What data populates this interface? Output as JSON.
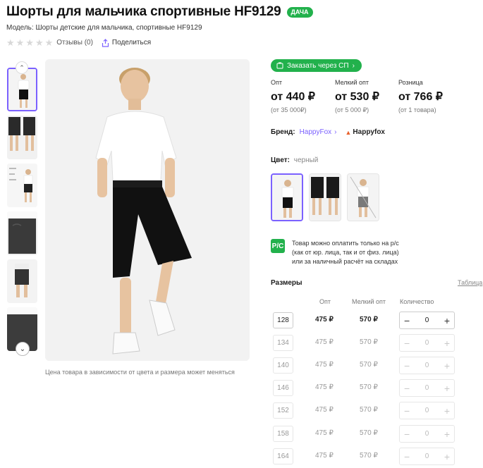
{
  "product": {
    "title": "Шорты для мальчика спортивные HF9129",
    "badge": "ДАЧА",
    "model_line": "Модель: Шорты детские для мальчика, спортивные HF9129",
    "reviews": "Отзывы (0)",
    "share": "Поделиться",
    "rating_stars": 0
  },
  "gallery": {
    "note": "Цена товара в зависимости от цвета и размера может меняться",
    "thumb_count": 6,
    "active_index": 0
  },
  "order_sp": {
    "label": "Заказать через СП",
    "icon": "cart-icon"
  },
  "prices": [
    {
      "label": "Опт",
      "value": "от 440 ₽",
      "sub": "(от 35 000₽)"
    },
    {
      "label": "Мелкий опт",
      "value": "от 530 ₽",
      "sub": "(от 5 000 ₽)"
    },
    {
      "label": "Розница",
      "value": "от 766 ₽",
      "sub": "(от 1 товара)"
    }
  ],
  "brand": {
    "label": "Бренд:",
    "name": "HappyFox",
    "logo_text": "Happyfox"
  },
  "color": {
    "label": "Цвет:",
    "value": "черный",
    "swatch_count": 3,
    "active_index": 0
  },
  "payment_note": {
    "icon_text": "Р/С",
    "line1": "Товар можно оплатить только на р/с",
    "line2": "(как от юр. лица, так и от физ. лица)",
    "line3": "или за наличный расчёт на складах"
  },
  "sizes": {
    "title": "Размеры",
    "table_link": "Таблица",
    "headers": {
      "opt": "Опт",
      "small_opt": "Мелкий опт",
      "qty": "Количество"
    },
    "rows": [
      {
        "size": "128",
        "opt": "475 ₽",
        "small_opt": "570 ₽",
        "qty": "0",
        "enabled": true
      },
      {
        "size": "134",
        "opt": "475 ₽",
        "small_opt": "570 ₽",
        "qty": "0",
        "enabled": false
      },
      {
        "size": "140",
        "opt": "475 ₽",
        "small_opt": "570 ₽",
        "qty": "0",
        "enabled": false
      },
      {
        "size": "146",
        "opt": "475 ₽",
        "small_opt": "570 ₽",
        "qty": "0",
        "enabled": false
      },
      {
        "size": "152",
        "opt": "475 ₽",
        "small_opt": "570 ₽",
        "qty": "0",
        "enabled": false
      },
      {
        "size": "158",
        "opt": "475 ₽",
        "small_opt": "570 ₽",
        "qty": "0",
        "enabled": false
      },
      {
        "size": "164",
        "opt": "475 ₽",
        "small_opt": "570 ₽",
        "qty": "0",
        "enabled": false
      }
    ],
    "minus": "−",
    "plus": "+"
  },
  "colors": {
    "accent": "#7b61ff",
    "green": "#22b14c"
  }
}
